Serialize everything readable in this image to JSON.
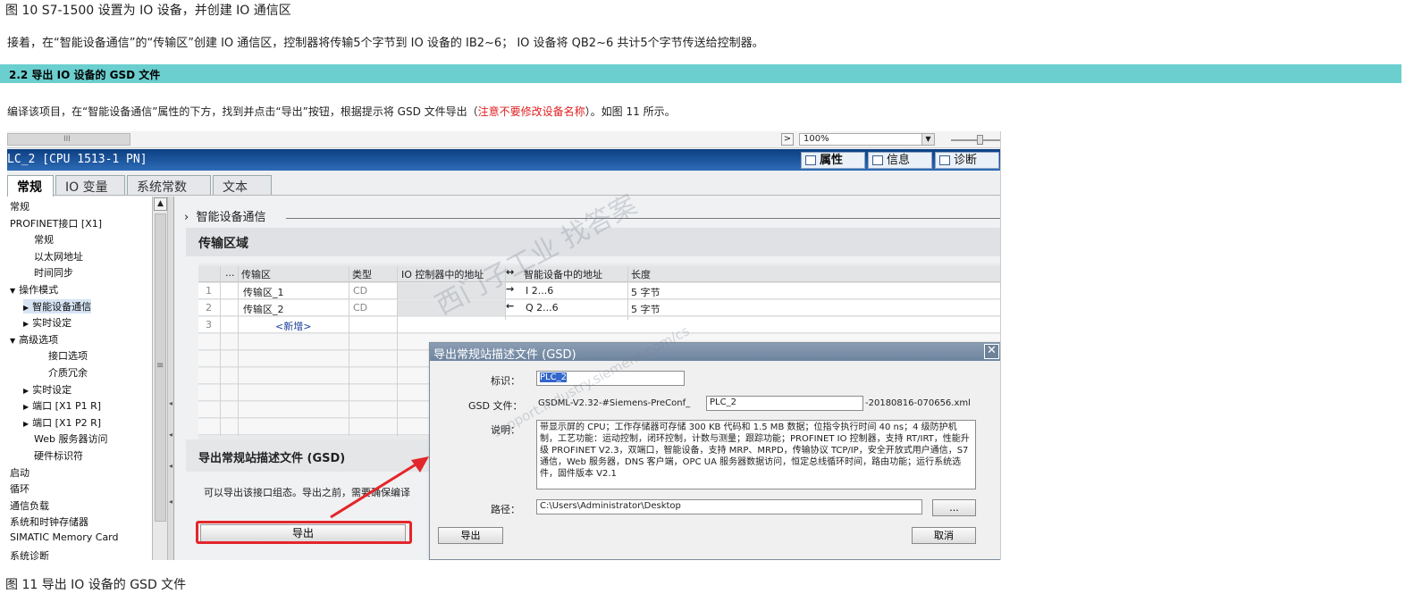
{
  "doc": {
    "caption_top": "图 10 S7-1500 设置为 IO 设备，并创建 IO 通信区",
    "paragraph1": "接着，在“智能设备通信”的“传输区”创建 IO 通信区，控制器将传输5个字节到 IO 设备的 IB2~6； IO 设备将 QB2~6 共计5个字节传送给控制器。",
    "section_heading": "2.2 导出 IO 设备的 GSD 文件",
    "paragraph2_a": "编译该项目，在“智能设备通信”属性的下方，找到并点击“导出”按钮，根据提示将 GSD 文件导出（",
    "paragraph2_red": "注意不要修改设备名称",
    "paragraph2_b": "）。如图 11 所示。",
    "caption_bottom": "图 11 导出 IO 设备的 GSD 文件",
    "section_color": "#6ccfcf",
    "note_color": "#e02020"
  },
  "tia": {
    "zoom_value": "100%",
    "grip": "III",
    "device_title": "LC_2 [CPU 1513-1 PN]",
    "right_tabs": [
      "属性",
      "信息",
      "诊断"
    ],
    "tabs": [
      "常规",
      "IO 变量",
      "系统常数",
      "文本"
    ],
    "tree": [
      {
        "label": "常规",
        "indent": 0,
        "arrow": ""
      },
      {
        "label": "PROFINET接口 [X1]",
        "indent": 0,
        "arrow": ""
      },
      {
        "label": "常规",
        "indent": 1,
        "arrow": ""
      },
      {
        "label": "以太网地址",
        "indent": 1,
        "arrow": ""
      },
      {
        "label": "时间同步",
        "indent": 1,
        "arrow": ""
      },
      {
        "label": "操作模式",
        "indent": 0,
        "arrow": "▼"
      },
      {
        "label": "智能设备通信",
        "indent": 1,
        "arrow": "▶"
      },
      {
        "label": "实时设定",
        "indent": 1,
        "arrow": "▶"
      },
      {
        "label": "高级选项",
        "indent": 0,
        "arrow": "▼"
      },
      {
        "label": "接口选项",
        "indent": 2,
        "arrow": ""
      },
      {
        "label": "介质冗余",
        "indent": 2,
        "arrow": ""
      },
      {
        "label": "实时设定",
        "indent": 1,
        "arrow": "▶"
      },
      {
        "label": "端口 [X1 P1 R]",
        "indent": 1,
        "arrow": "▶"
      },
      {
        "label": "端口 [X1 P2 R]",
        "indent": 1,
        "arrow": "▶"
      },
      {
        "label": "Web 服务器访问",
        "indent": 1,
        "arrow": ""
      },
      {
        "label": "硬件标识符",
        "indent": 1,
        "arrow": ""
      },
      {
        "label": "启动",
        "indent": 0,
        "arrow": ""
      },
      {
        "label": "循环",
        "indent": 0,
        "arrow": ""
      },
      {
        "label": "通信负载",
        "indent": 0,
        "arrow": ""
      },
      {
        "label": "系统和时钟存储器",
        "indent": 0,
        "arrow": ""
      },
      {
        "label": "SIMATIC Memory Card",
        "indent": 0,
        "arrow": ""
      },
      {
        "label": "系统诊断",
        "indent": 0,
        "arrow": ""
      }
    ],
    "breadcrumb": "智能设备通信",
    "transfer_title": "传输区域",
    "grid_headers": {
      "dots": "...",
      "name": "传输区",
      "type": "类型",
      "ctrl_addr": "IO 控制器中的地址",
      "dir": "↔",
      "dev_addr": "智能设备中的地址",
      "len": "长度"
    },
    "rows": [
      {
        "num": "1",
        "name": "传输区_1",
        "type": "CD",
        "dir": "→",
        "dev_addr": "I 2...6",
        "len": "5 字节"
      },
      {
        "num": "2",
        "name": "传输区_2",
        "type": "CD",
        "dir": "←",
        "dev_addr": "Q 2...6",
        "len": "5 字节"
      }
    ],
    "row3_num": "3",
    "new_row": "<新增>",
    "export_section_title": "导出常规站描述文件 (GSD)",
    "export_hint": "可以导出该接口组态。导出之前，需要确保编译",
    "export_button": "导出"
  },
  "dialog": {
    "title": "导出常规站描述文件 (GSD)",
    "close": "✕",
    "id_label": "标识：",
    "id_value": "PLC_2",
    "gsd_label": "GSD 文件：",
    "gsd_prefix": "GSDML-V2.32-#Siemens-PreConf_",
    "gsd_name": "PLC_2",
    "gsd_suffix": "-20180816-070656.xml",
    "desc_label": "说明：",
    "desc_text": "带显示屏的 CPU；工作存储器可存储 300 KB 代码和 1.5 MB 数据；位指令执行时间 40 ns；4 级防护机制，工艺功能：运动控制，闭环控制，计数与测量；跟踪功能；PROFINET IO 控制器，支持 RT/IRT，性能升级 PROFINET V2.3，双端口，智能设备，支持 MRP、MRPD，传输协议 TCP/IP，安全开放式用户通信，S7 通信，Web 服务器，DNS 客户端，OPC UA 服务器数据访问，恒定总线循环时间，路由功能；运行系统选件，固件版本 V2.1",
    "path_label": "路径：",
    "path_value": "C:\\Users\\Administrator\\Desktop",
    "browse": "...",
    "export_btn": "导出",
    "cancel_btn": "取消"
  },
  "watermark": {
    "line1": "西门子工业 找答案",
    "line2": "support.industry.siemens.com/cs"
  }
}
